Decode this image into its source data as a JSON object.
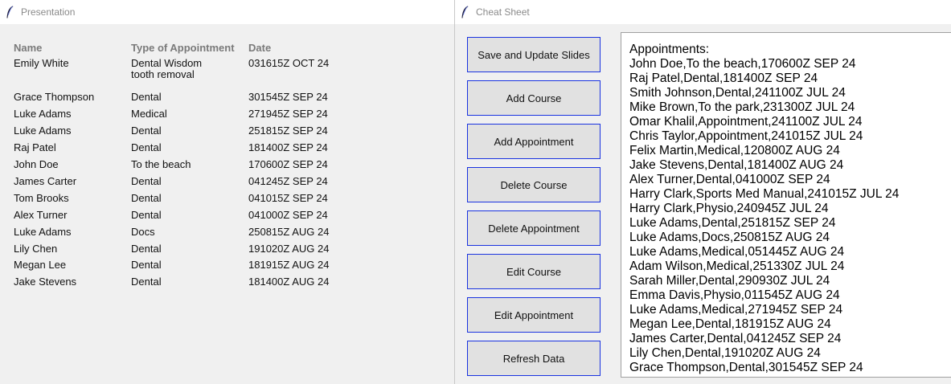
{
  "presentation": {
    "title": "Presentation",
    "headers": {
      "name": "Name",
      "type": "Type of Appointment",
      "date": "Date"
    },
    "rows": [
      {
        "name": "Emily White",
        "type": "Dental Wisdom",
        "type2": "tooth removal",
        "date": "031615Z OCT 24"
      },
      {
        "name": "Grace Thompson",
        "type": "Dental",
        "date": "301545Z SEP 24"
      },
      {
        "name": "Luke Adams",
        "type": "Medical",
        "date": "271945Z SEP 24"
      },
      {
        "name": "Luke Adams",
        "type": "Dental",
        "date": "251815Z SEP 24"
      },
      {
        "name": "Raj Patel",
        "type": "Dental",
        "date": "181400Z SEP 24"
      },
      {
        "name": "John Doe",
        "type": "To the beach",
        "date": "170600Z SEP 24"
      },
      {
        "name": "James Carter",
        "type": "Dental",
        "date": "041245Z SEP 24"
      },
      {
        "name": "Tom Brooks",
        "type": "Dental",
        "date": "041015Z SEP 24"
      },
      {
        "name": "Alex Turner",
        "type": "Dental",
        "date": "041000Z SEP 24"
      },
      {
        "name": "Luke Adams",
        "type": "Docs",
        "date": "250815Z AUG 24"
      },
      {
        "name": "Lily Chen",
        "type": "Dental",
        "date": "191020Z AUG 24"
      },
      {
        "name": "Megan Lee",
        "type": "Dental",
        "date": "181915Z AUG 24"
      },
      {
        "name": "Jake Stevens",
        "type": "Dental",
        "date": "181400Z AUG 24"
      }
    ]
  },
  "cheat_sheet": {
    "title": "Cheat Sheet",
    "buttons": [
      "Save and Update Slides",
      "Add Course",
      "Add Appointment",
      "Delete Course",
      "Delete Appointment",
      "Edit Course",
      "Edit Appointment",
      "Refresh Data"
    ],
    "text_lines": [
      "Appointments:",
      "John Doe,To the beach,170600Z SEP 24",
      "Raj Patel,Dental,181400Z SEP 24",
      "Smith Johnson,Dental,241100Z JUL 24",
      "Mike Brown,To the park,231300Z JUL 24",
      "Omar Khalil,Appointment,241100Z JUL 24",
      "Chris Taylor,Appointment,241015Z JUL 24",
      "Felix Martin,Medical,120800Z AUG 24",
      "Jake Stevens,Dental,181400Z AUG 24",
      "Alex Turner,Dental,041000Z SEP 24",
      "Harry Clark,Sports Med Manual,241015Z JUL 24",
      "Harry Clark,Physio,240945Z JUL 24",
      "Luke Adams,Dental,251815Z SEP 24",
      "Luke Adams,Docs,250815Z AUG 24",
      "Luke Adams,Medical,051445Z AUG 24",
      "Adam Wilson,Medical,251330Z JUL 24",
      "Sarah Miller,Dental,290930Z JUL 24",
      "Emma Davis,Physio,011545Z AUG 24",
      "Luke Adams,Medical,271945Z SEP 24",
      "Megan Lee,Dental,181915Z AUG 24",
      "James Carter,Dental,041245Z SEP 24",
      "Lily Chen,Dental,191020Z AUG 24",
      "Grace Thompson,Dental,301545Z SEP 24"
    ]
  },
  "icons": {
    "app_icon": "feather-icon"
  }
}
